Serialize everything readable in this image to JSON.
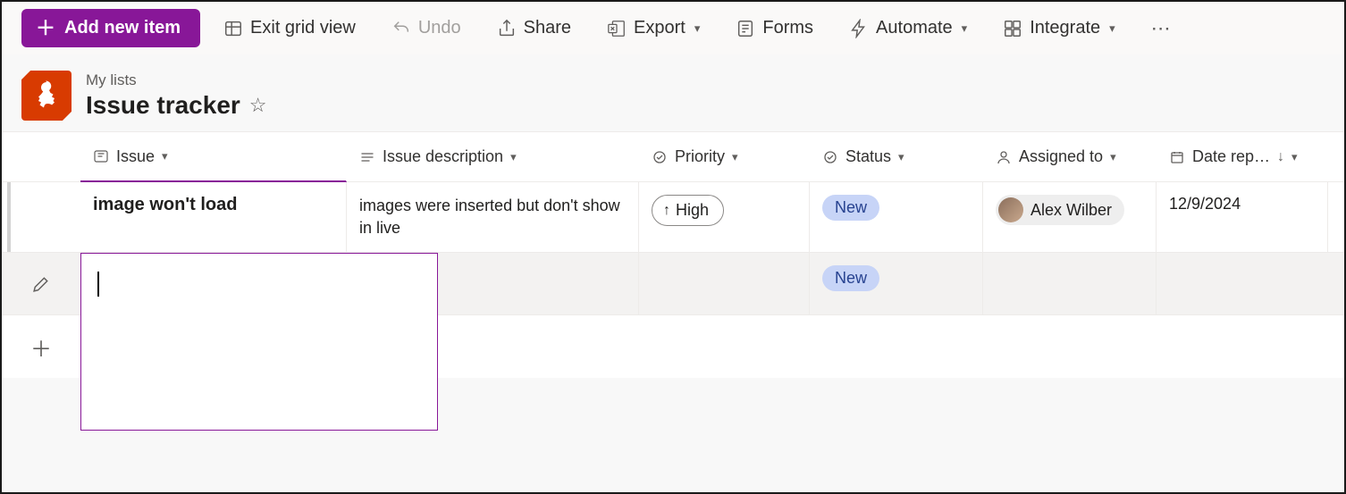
{
  "toolbar": {
    "add_new": "Add new item",
    "exit_grid": "Exit grid view",
    "undo": "Undo",
    "share": "Share",
    "export": "Export",
    "forms": "Forms",
    "automate": "Automate",
    "integrate": "Integrate"
  },
  "header": {
    "breadcrumb": "My lists",
    "title": "Issue tracker"
  },
  "columns": {
    "issue": "Issue",
    "desc": "Issue description",
    "priority": "Priority",
    "status": "Status",
    "assigned": "Assigned to",
    "date": "Date rep…"
  },
  "rows": [
    {
      "issue": "image won't load",
      "desc": "images were inserted but don't show in live",
      "priority": "High",
      "status": "New",
      "assigned": "Alex Wilber",
      "date": "12/9/2024"
    },
    {
      "issue": "",
      "desc": "",
      "priority": "",
      "status": "New",
      "assigned": "",
      "date": ""
    }
  ]
}
